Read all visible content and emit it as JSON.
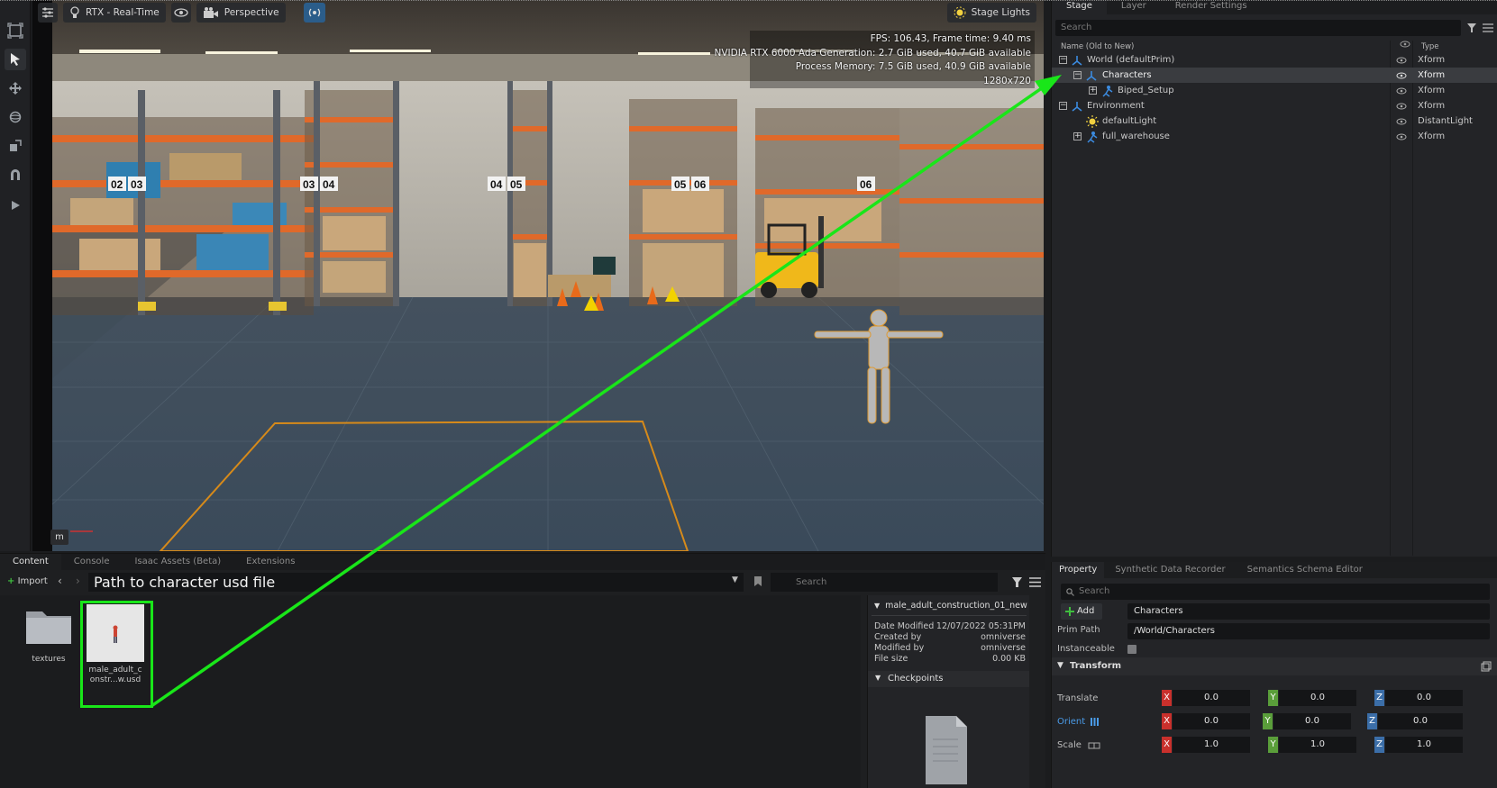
{
  "viewport": {
    "toolbar": {
      "renderer": "RTX - Real-Time",
      "camera": "Perspective",
      "stage_lights": "Stage Lights"
    },
    "hud": {
      "fps": "FPS: 106.43, Frame time: 9.40 ms",
      "gpu": "NVIDIA RTX 6000 Ada Generation: 2.7 GiB used, 40.7 GiB available",
      "memory": "Process Memory: 7.5 GiB used, 40.9 GiB available",
      "resolution": "1280x720"
    },
    "camera_badge": "m",
    "rack_labels": [
      "02",
      "03",
      "03",
      "04",
      "04",
      "05",
      "05",
      "06",
      "06"
    ]
  },
  "left_toolbar": {
    "icons": [
      "frame-icon",
      "select-arrow-icon",
      "move-icon",
      "rotate-icon",
      "scale-icon",
      "snap-icon",
      "play-icon"
    ]
  },
  "stage": {
    "tabs": [
      "Stage",
      "Layer",
      "Render Settings"
    ],
    "search_placeholder": "Search",
    "col_name": "Name (Old to New)",
    "col_type": "Type",
    "rows": [
      {
        "name": "World (defaultPrim)",
        "type": "Xform",
        "expander": "−"
      },
      {
        "name": "Characters",
        "type": "Xform",
        "expander": "−"
      },
      {
        "name": "Biped_Setup",
        "type": "Xform",
        "expander": "+"
      },
      {
        "name": "Environment",
        "type": "Xform",
        "expander": "−"
      },
      {
        "name": "defaultLight",
        "type": "DistantLight",
        "expander": ""
      },
      {
        "name": "full_warehouse",
        "type": "Xform",
        "expander": "+"
      }
    ]
  },
  "property": {
    "tabs": [
      "Property",
      "Synthetic Data Recorder",
      "Semantics Schema Editor"
    ],
    "search_placeholder": "Search",
    "add_label": "Add",
    "name_value": "Characters",
    "prim_path_label": "Prim Path",
    "prim_path_value": "/World/Characters",
    "instanceable_label": "Instanceable",
    "transform_label": "Transform",
    "translate_label": "Translate",
    "orient_label": "Orient",
    "scale_label": "Scale",
    "translate": [
      "0.0",
      "0.0",
      "0.0"
    ],
    "orient": [
      "0.0",
      "0.0",
      "0.0"
    ],
    "scale": [
      "1.0",
      "1.0",
      "1.0"
    ],
    "axis_letters": [
      "X",
      "Y",
      "Z"
    ]
  },
  "content": {
    "tabs": [
      "Content",
      "Console",
      "Isaac Assets (Beta)",
      "Extensions"
    ],
    "import_label": "Import",
    "path_annotation": "Path to character usd file",
    "search_placeholder": "Search",
    "files": [
      {
        "name": "textures"
      },
      {
        "name": "male_adult_construction_01_new.usd",
        "name_line1": "male_adult_c",
        "name_line2": "onstr...w.usd"
      }
    ],
    "details": {
      "title": "male_adult_construction_01_new",
      "date_modified_label": "Date Modified",
      "date_modified": "12/07/2022 05:31PM",
      "created_by_label": "Created by",
      "created_by": "omniverse",
      "modified_by_label": "Modified by",
      "modified_by": "omniverse",
      "file_size_label": "File size",
      "file_size": "0.00 KB",
      "checkpoints_label": "Checkpoints"
    }
  },
  "colors": {
    "annotation_green": "#19e619",
    "selection_row": "#3a3c40",
    "axis_x": "#c9302c",
    "axis_y": "#5a9e3a",
    "axis_z": "#3b6ea8"
  }
}
